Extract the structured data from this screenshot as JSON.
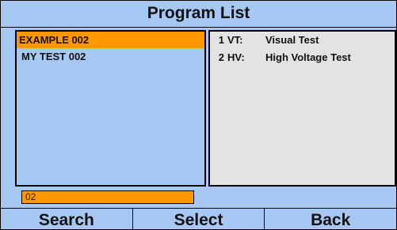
{
  "header": {
    "title": "Program List"
  },
  "program_list": {
    "items": [
      {
        "name": "EXAMPLE 002",
        "selected": true
      },
      {
        "name": "MY TEST 002",
        "selected": false
      }
    ]
  },
  "steps": {
    "items": [
      {
        "number": "1",
        "code": "VT:",
        "description": "Visual Test"
      },
      {
        "number": "2",
        "code": "HV:",
        "description": "High Voltage Test"
      }
    ]
  },
  "search": {
    "value": "02"
  },
  "softkeys": {
    "search_label": "Search",
    "select_label": "Select",
    "back_label": "Back"
  },
  "colors": {
    "background": "#a8c8f4",
    "selection": "#ff9800",
    "step_panel": "#e3e3e3",
    "border": "#000000"
  }
}
